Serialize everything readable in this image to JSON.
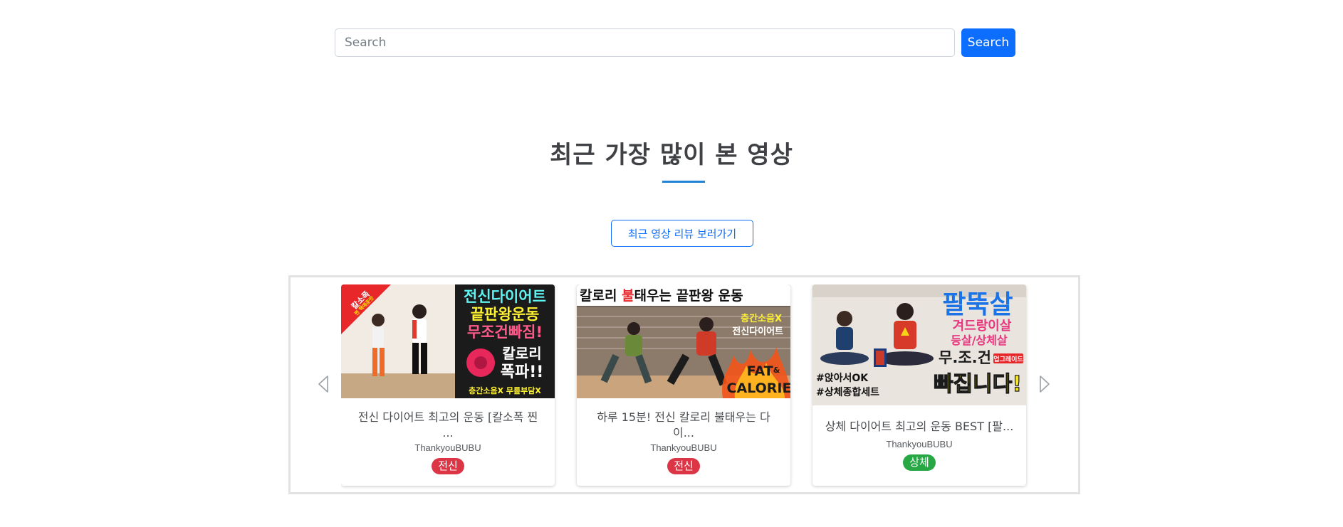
{
  "search": {
    "placeholder": "Search",
    "value": "",
    "button_label": "Search"
  },
  "section": {
    "title": "최근 가장 많이 본 영상",
    "review_button_label": "최근 영상 리뷰 보러가기"
  },
  "carousel": {
    "prev_icon": "chevron-left-icon",
    "next_icon": "chevron-right-icon",
    "videos": [
      {
        "title_line1": "전신 다이어트 최고의 운동 [칼소폭 찐",
        "title_line2": "...",
        "channel": "ThankyouBUBU",
        "category": "전신",
        "category_color": "#dc3545",
        "thumb": {
          "corner_lines": [
            "칼소폭",
            "찐 핵매운맛"
          ],
          "lines": [
            "전신다이어트",
            "끝판왕운동",
            "무조건빠짐!",
            "칼로리",
            "폭파!!",
            "층간소음X 무릎부담X"
          ]
        }
      },
      {
        "title_line1": "하루 15분! 전신 칼로리 불태우는 다",
        "title_line2": "이...",
        "channel": "ThankyouBUBU",
        "category": "전신",
        "category_color": "#dc3545",
        "thumb": {
          "headline_a": "칼로리 ",
          "headline_b": "불",
          "headline_c": "태우는 끝판왕 운동",
          "sub_lines": [
            "층간소음X",
            "전신다이어트"
          ],
          "fat": "FAT",
          "amp": "&",
          "calorie": "CALORIE"
        }
      },
      {
        "title_line1": "상체 다이어트 최고의 운동 BEST [팔...",
        "title_line2": "",
        "channel": "ThankyouBUBU",
        "category": "상체",
        "category_color": "#28a745",
        "thumb": {
          "lines": [
            "팔뚝살",
            "겨드랑이살",
            "등살/상체살",
            "무.조.건",
            "빠집니다!"
          ],
          "tag": "업그레이드",
          "hashtags": [
            "#앉아서OK",
            "#상체종합세트"
          ]
        }
      }
    ]
  }
}
